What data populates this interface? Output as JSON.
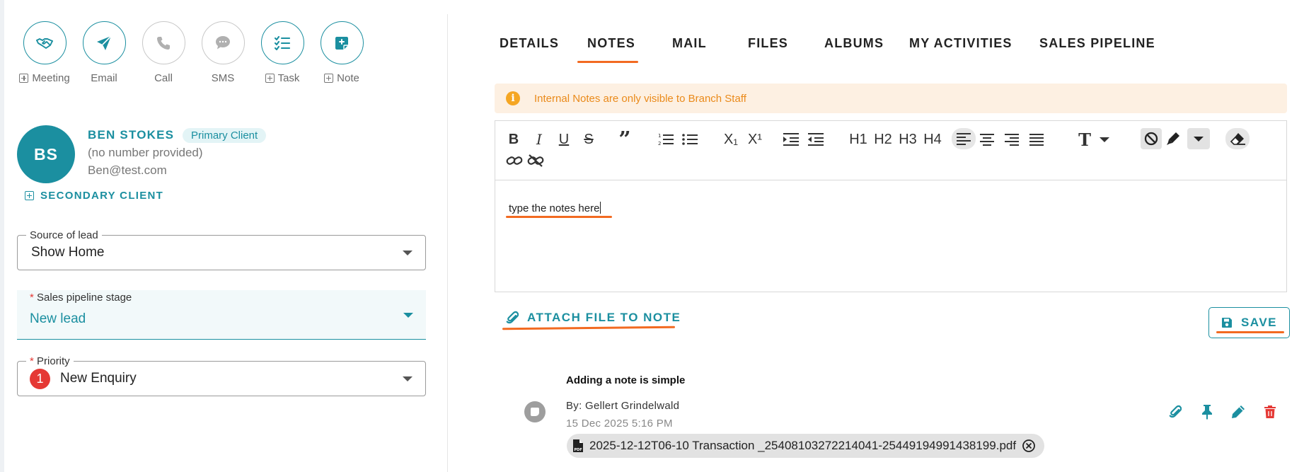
{
  "actions": [
    {
      "label": "Meeting",
      "icon": "handshake-icon",
      "enabled": true,
      "plus": true
    },
    {
      "label": "Email",
      "icon": "send-icon",
      "enabled": true,
      "plus": false
    },
    {
      "label": "Call",
      "icon": "phone-icon",
      "enabled": false,
      "plus": false
    },
    {
      "label": "SMS",
      "icon": "sms-icon",
      "enabled": false,
      "plus": false
    },
    {
      "label": "Task",
      "icon": "checklist-icon",
      "enabled": true,
      "plus": true
    },
    {
      "label": "Note",
      "icon": "note-add-icon",
      "enabled": true,
      "plus": true
    }
  ],
  "client": {
    "initials": "BS",
    "name": "BEN STOKES",
    "badge": "Primary Client",
    "phone": "(no number provided)",
    "email": "Ben@test.com",
    "secondary_label": "SECONDARY CLIENT"
  },
  "fields": {
    "source": {
      "label": "Source of lead",
      "value": "Show Home"
    },
    "stage": {
      "required_mark": "*",
      "label": "Sales pipeline stage",
      "value": "New lead"
    },
    "priority": {
      "required_mark": "*",
      "label": "Priority",
      "badge": "1",
      "value": "New Enquiry"
    }
  },
  "tabs": [
    {
      "label": "DETAILS",
      "active": false
    },
    {
      "label": "NOTES",
      "active": true
    },
    {
      "label": "MAIL",
      "active": false
    },
    {
      "label": "FILES",
      "active": false
    },
    {
      "label": "ALBUMS",
      "active": false
    },
    {
      "label": "MY ACTIVITIES",
      "active": false
    },
    {
      "label": "SALES PIPELINE",
      "active": false
    }
  ],
  "notice": {
    "icon": "info-icon",
    "text": "Internal Notes are only visible to Branch Staff"
  },
  "editor": {
    "toolbar": {
      "h1": "H1",
      "h2": "H2",
      "h3": "H3",
      "h4": "H4",
      "bold": "B",
      "italic": "I",
      "underline": "U",
      "strike": "S",
      "subscript": "X₁",
      "superscript": "X¹",
      "text_type": "T"
    },
    "content": "type the notes here"
  },
  "attach_label": "ATTACH FILE TO NOTE",
  "save_label": "SAVE",
  "note": {
    "title": "Adding a note is simple",
    "by": "By: Gellert Grindelwald",
    "date": "15 Dec 2025 5:16 PM",
    "attachment": "2025-12-12T06-10 Transaction _25408103272214041-25449194991438199.pdf"
  },
  "colors": {
    "accent": "#1b8fa0",
    "highlight": "#f26a21",
    "danger": "#e53935",
    "notice_bg": "#fdf0e2",
    "notice_text": "#ea8a1a"
  }
}
